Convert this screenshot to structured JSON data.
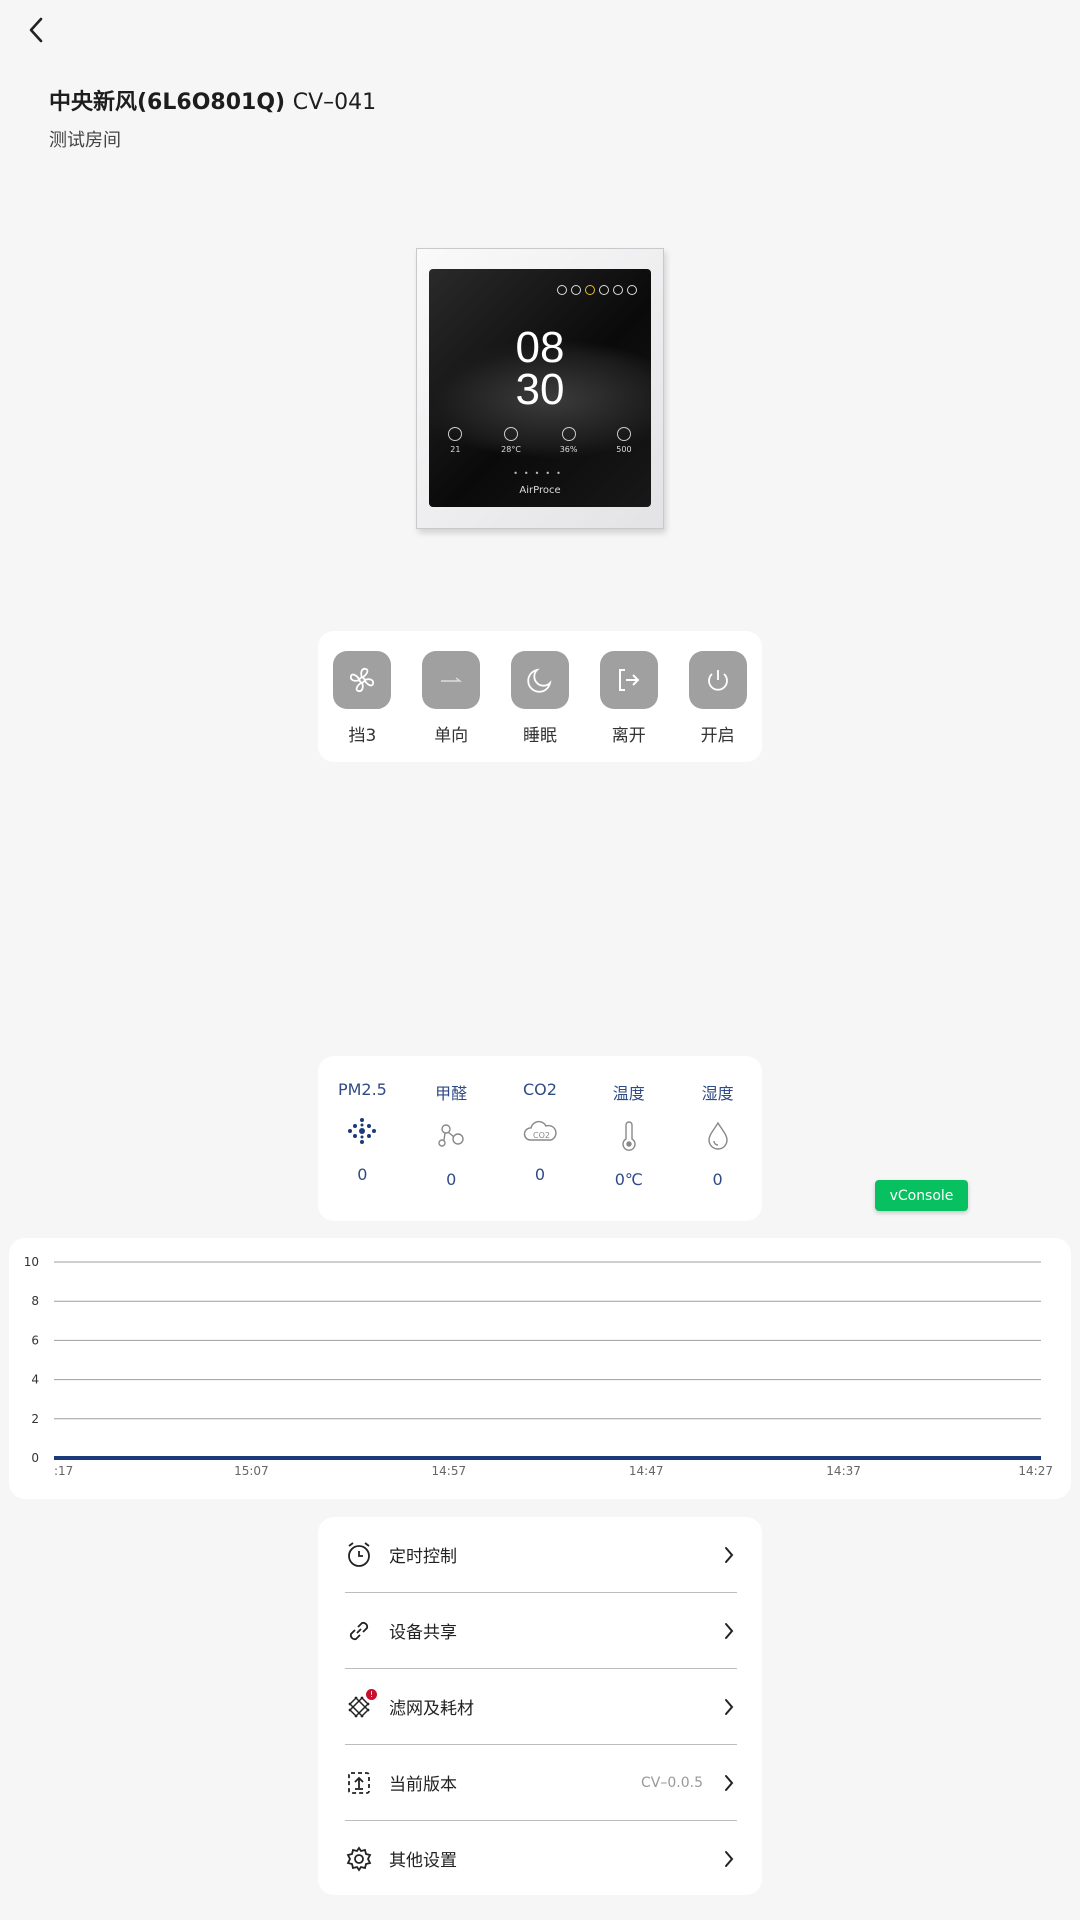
{
  "header": {
    "title_main": "中央新风(6L6O801Q)",
    "title_code": "CV–041",
    "room": "测试房间"
  },
  "device_image": {
    "time_hour": "08",
    "time_minute": "30",
    "sensor_values": [
      "21",
      "28°C",
      "36%",
      "500"
    ],
    "brand": "AirProce"
  },
  "controls": [
    {
      "label": "挡3",
      "icon": "fan-icon"
    },
    {
      "label": "单向",
      "icon": "arrow-right-icon"
    },
    {
      "label": "睡眠",
      "icon": "moon-icon"
    },
    {
      "label": "离开",
      "icon": "exit-icon"
    },
    {
      "label": "开启",
      "icon": "power-icon"
    }
  ],
  "metrics": [
    {
      "name": "PM2.5",
      "value": "0",
      "icon": "pm25-icon"
    },
    {
      "name": "甲醛",
      "value": "0",
      "icon": "molecule-icon"
    },
    {
      "name": "CO2",
      "value": "0",
      "icon": "co2-cloud-icon"
    },
    {
      "name": "温度",
      "value": "0℃",
      "icon": "thermometer-icon"
    },
    {
      "name": "湿度",
      "value": "0",
      "icon": "droplet-icon"
    }
  ],
  "vconsole_label": "vConsole",
  "chart_data": {
    "type": "line",
    "x": [
      ":17",
      "15:07",
      "14:57",
      "14:47",
      "14:37",
      "14:27"
    ],
    "series": [
      {
        "values": [
          0,
          0,
          0,
          0,
          0,
          0
        ]
      }
    ],
    "yticks": [
      0,
      2,
      4,
      6,
      8,
      10
    ],
    "ylim": [
      0,
      10
    ],
    "grid": true,
    "line_color": "#1a3a7a"
  },
  "menu": [
    {
      "label": "定时控制",
      "icon": "alarm-clock-icon",
      "value": ""
    },
    {
      "label": "设备共享",
      "icon": "link-icon",
      "value": ""
    },
    {
      "label": "滤网及耗材",
      "icon": "filter-icon",
      "value": "",
      "badge": "!"
    },
    {
      "label": "当前版本",
      "icon": "upgrade-icon",
      "value": "CV–0.0.5"
    },
    {
      "label": "其他设置",
      "icon": "gear-icon",
      "value": ""
    }
  ]
}
